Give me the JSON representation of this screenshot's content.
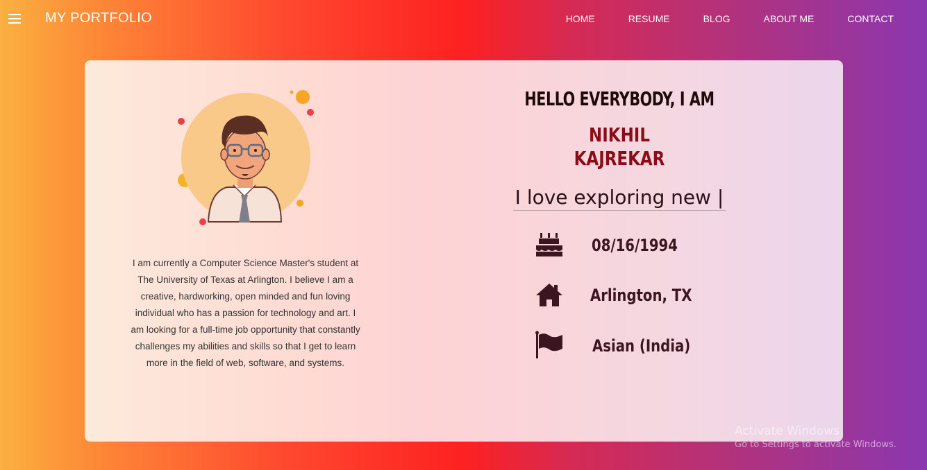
{
  "nav": {
    "menu_icon": "hamburger-icon",
    "brand": "MY PORTFOLIO",
    "links": [
      "HOME",
      "RESUME",
      "BLOG",
      "ABOUT ME",
      "CONTACT"
    ]
  },
  "profile": {
    "avatar_icon": "avatar-illustration",
    "about": "I am currently a Computer Science Master's student at The University of Texas at Arlington. I believe I am a creative, hardworking, open minded and fun loving individual who has a passion for technology and art. I am looking for a full-time job opportunity that constantly challenges my abilities and skills so that I get to learn more in the field of web, software, and systems."
  },
  "intro": {
    "greeting": "HELLO EVERYBODY, I AM",
    "first_name": "NIKHIL",
    "last_name": "KAJREKAR",
    "typing_text": "I love exploring new |"
  },
  "info": [
    {
      "icon": "birthday-cake-icon",
      "text": "08/16/1994"
    },
    {
      "icon": "home-icon",
      "text": "Arlington, TX"
    },
    {
      "icon": "flag-icon",
      "text": "Asian (India)"
    }
  ],
  "watermark": {
    "line1": "Activate Windows",
    "line2": "Go to Settings to activate Windows."
  },
  "colors": {
    "name": "#8b0b16",
    "icons": "#3b1520",
    "avatar_bg": "#f9c98a"
  }
}
